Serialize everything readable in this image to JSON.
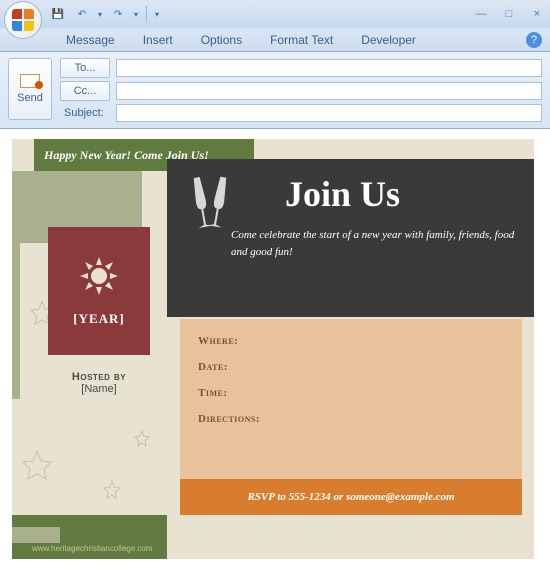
{
  "qat": {
    "save": "💾",
    "undo": "↶",
    "redo": "↷"
  },
  "window": {
    "min": "—",
    "max": "□",
    "close": "×"
  },
  "ribbon": {
    "tabs": [
      "Message",
      "Insert",
      "Options",
      "Format Text",
      "Developer"
    ],
    "help": "?"
  },
  "compose": {
    "send": "Send",
    "to": "To...",
    "cc": "Cc...",
    "subject_label": "Subject:",
    "to_value": "",
    "cc_value": "",
    "subject_value": ""
  },
  "invite": {
    "banner": "Happy New Year!  Come Join Us!",
    "title": "Join Us",
    "subtitle": "Come celebrate the start of a new year with family, friends, food and good fun!",
    "year": "[YEAR]",
    "hosted_label": "Hosted by",
    "hosted_name": "[Name]",
    "fields": {
      "where": "Where:",
      "date": "Date:",
      "time": "Time:",
      "directions": "Directions:"
    },
    "rsvp": "RSVP to 555-1234 or someone@example.com",
    "watermark": "www.heritagechristiancollege.com"
  }
}
